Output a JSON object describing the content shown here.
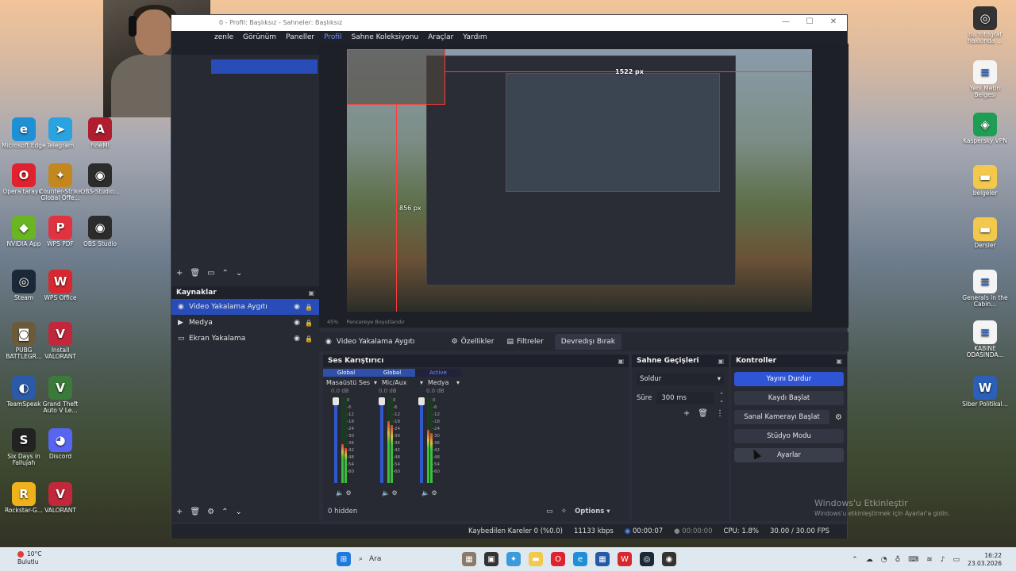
{
  "obs": {
    "window_title": "0 - Profil: Başlıksız - Sahneler: Başlıksız",
    "menu": [
      "zenle",
      "Görünüm",
      "Paneller",
      "Profil",
      "Sahne Koleksiyonu",
      "Araçlar",
      "Yardım"
    ],
    "preview": {
      "label_width": "1522 px",
      "label_height": "856 px",
      "zoom_text": "45%",
      "zoom_fit": "Pencereye Boyutlandır"
    },
    "sources": {
      "title": "Kaynaklar",
      "items": [
        {
          "label": "Video Yakalama Aygıtı",
          "icon": "camera-icon",
          "active": true
        },
        {
          "label": "Medya",
          "icon": "play-icon",
          "active": false
        },
        {
          "label": "Ekran Yakalama",
          "icon": "monitor-icon",
          "active": false
        }
      ]
    },
    "props_bar": {
      "source_name": "Video Yakalama Aygıtı",
      "properties": "Özellikler",
      "filters": "Filtreler",
      "deactivate": "Devredışı Bırak"
    },
    "mixer": {
      "title": "Ses Karıştırıcı",
      "tabs": [
        "Global",
        "Global",
        "Active"
      ],
      "channels": [
        {
          "name": "Masaüstü Ses",
          "db": "0.0 dB",
          "level": 0.45
        },
        {
          "name": "Mic/Aux",
          "db": "0.0 dB",
          "level": 0.72
        },
        {
          "name": "Medya",
          "db": "0.0 dB",
          "level": 0.62
        }
      ],
      "scale": [
        "0",
        "-6",
        "-12",
        "-18",
        "-24",
        "-30",
        "-36",
        "-42",
        "-48",
        "-54",
        "-60"
      ],
      "hidden_label": "0 hidden",
      "options_label": "Options"
    },
    "transitions": {
      "title": "Sahne Geçişleri",
      "selected": "Soldur",
      "duration_label": "Süre",
      "duration_value": "300 ms"
    },
    "controls": {
      "title": "Kontroller",
      "stop_stream": "Yayını Durdur",
      "start_record": "Kaydı Başlat",
      "virtual_cam": "Sanal Kamerayı Başlat",
      "studio_mode": "Stüdyo Modu",
      "settings": "Ayarlar"
    },
    "status": {
      "dropped": "Kaybedilen Kareler 0 (%0.0)",
      "bitrate": "11133 kbps",
      "stream_time": "00:00:07",
      "rec_time": "00:00:00",
      "cpu": "CPU: 1.8%",
      "fps": "30.00 / 30.00 FPS"
    }
  },
  "desktop": {
    "left_icons": [
      {
        "label": "Microsoft Edge",
        "icon": "edge-icon",
        "color": "#1f8fd6"
      },
      {
        "label": "Telegram",
        "icon": "telegram-icon",
        "color": "#2aa3e0"
      },
      {
        "label": "FineMI",
        "icon": "finemi-icon",
        "color": "#b01d2e"
      },
      {
        "label": "Opera tarayıcı",
        "icon": "opera-icon",
        "color": "#e0222e"
      },
      {
        "label": "Counter-Strike Global Offe...",
        "icon": "csgo-icon",
        "color": "#c4871e"
      },
      {
        "label": "OBS-Studio...",
        "icon": "obs-icon",
        "color": "#2c2c2c"
      },
      {
        "label": "NVIDIA App",
        "icon": "nvidia-icon",
        "color": "#6ab522"
      },
      {
        "label": "WPS PDF",
        "icon": "wps-pdf-icon",
        "color": "#e0333f"
      },
      {
        "label": "OBS Studio",
        "icon": "obs-icon",
        "color": "#2c2c2c"
      },
      {
        "label": "Steam",
        "icon": "steam-icon",
        "color": "#1b2838"
      },
      {
        "label": "WPS Office",
        "icon": "wps-office-icon",
        "color": "#d8282f"
      },
      {
        "label": "PUBG BATTLEGR...",
        "icon": "pubg-icon",
        "color": "#6b5b3a"
      },
      {
        "label": "Install VALORANT",
        "icon": "valorant-icon",
        "color": "#c2283b"
      },
      {
        "label": "TeamSpeak",
        "icon": "teamspeak-icon",
        "color": "#2b5aa8"
      },
      {
        "label": "Grand Theft Auto V Le...",
        "icon": "gta-icon",
        "color": "#3b7a3a"
      },
      {
        "label": "Six Days in Fallujah",
        "icon": "sixdays-icon",
        "color": "#222"
      },
      {
        "label": "Discord",
        "icon": "discord-icon",
        "color": "#5865f2"
      },
      {
        "label": "Rockstar-G...",
        "icon": "rockstar-icon",
        "color": "#f0b21c"
      },
      {
        "label": "VALORANT",
        "icon": "valorant-icon",
        "color": "#c2283b"
      }
    ],
    "right_icons": [
      {
        "label": "Bu fotoğraf hakkında ...",
        "icon": "camera-info-icon",
        "color": "#333"
      },
      {
        "label": "Yeni Metin Belgesi",
        "icon": "text-doc-icon",
        "color": "#f4f4f4"
      },
      {
        "label": "Kaspersky VPN",
        "icon": "kaspersky-icon",
        "color": "#1f9d55"
      },
      {
        "label": "belgeler",
        "icon": "folder-icon",
        "color": "#f2c94c"
      },
      {
        "label": "Dersler",
        "icon": "folder-icon",
        "color": "#f2c94c"
      },
      {
        "label": "Generals in the Cabin...",
        "icon": "doc-icon",
        "color": "#f4f4f4"
      },
      {
        "label": "KABINE ODASINDA...",
        "icon": "doc-icon",
        "color": "#f4f4f4"
      },
      {
        "label": "Siber Politikal...",
        "icon": "word-icon",
        "color": "#2b5fb8"
      }
    ],
    "activation_title": "Windows'u Etkinleştir",
    "activation_sub": "Windows'u etkinleştirmek için Ayarlar'a gidin."
  },
  "taskbar": {
    "weather_temp": "10°C",
    "weather_desc": "Bulutlu",
    "search_placeholder": "Ara",
    "time": "16:22",
    "date": "23.03.2026"
  }
}
